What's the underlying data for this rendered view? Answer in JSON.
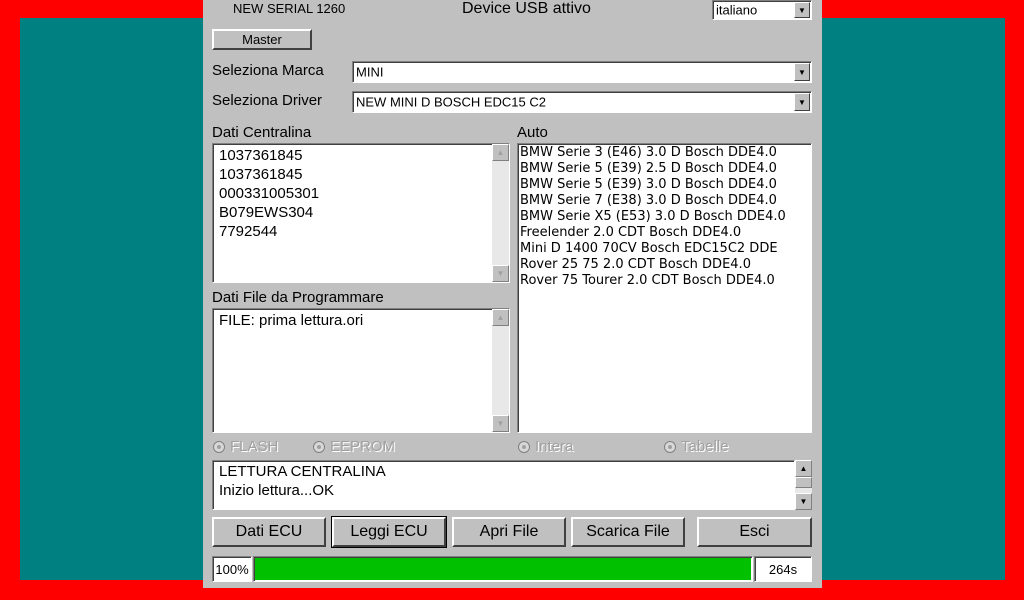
{
  "header": {
    "serial": "NEW SERIAL 1260",
    "device_status": "Device USB attivo",
    "language_select": "italiano"
  },
  "master_button": "Master",
  "selects": {
    "marca_label": "Seleziona Marca",
    "marca_value": "MINI",
    "driver_label": "Seleziona Driver",
    "driver_value": "NEW MINI D BOSCH EDC15 C2"
  },
  "dati_centralina": {
    "label": "Dati Centralina",
    "lines": [
      "1037361845",
      "1037361845",
      "000331005301",
      "B079EWS304",
      "7792544"
    ]
  },
  "auto": {
    "label": "Auto",
    "lines": [
      "BMW Serie 3 (E46) 3.0 D Bosch DDE4.0",
      "BMW Serie 5 (E39) 2.5 D Bosch DDE4.0",
      "BMW Serie 5 (E39) 3.0 D Bosch DDE4.0",
      "BMW Serie 7 (E38) 3.0 D Bosch DDE4.0",
      "BMW Serie X5 (E53) 3.0 D Bosch DDE4.0",
      "Freelender 2.0 CDT Bosch DDE4.0",
      "Mini D 1400 70CV Bosch EDC15C2 DDE",
      "Rover 25 75 2.0 CDT Bosch DDE4.0",
      "Rover 75 Tourer 2.0 CDT Bosch DDE4.0"
    ]
  },
  "dati_file": {
    "label": "Dati File da Programmare",
    "lines": [
      "FILE: prima lettura.ori"
    ]
  },
  "radios": {
    "flash": "FLASH",
    "eeprom": "EEPROM",
    "intera": "Intera",
    "tabelle": "Tabelle"
  },
  "log": {
    "lines": [
      "LETTURA CENTRALINA",
      "Inizio lettura...OK"
    ]
  },
  "buttons": {
    "dati_ecu": "Dati ECU",
    "leggi_ecu": "Leggi ECU",
    "apri_file": "Apri File",
    "scarica_file": "Scarica File",
    "esci": "Esci"
  },
  "progress": {
    "percent_label": "100%",
    "fraction": 1.0,
    "time_label": "264s",
    "color": "#00c000"
  },
  "colors": {
    "outer_border": "#ff0000",
    "desktop": "#008080",
    "window": "#c0c0c0"
  }
}
